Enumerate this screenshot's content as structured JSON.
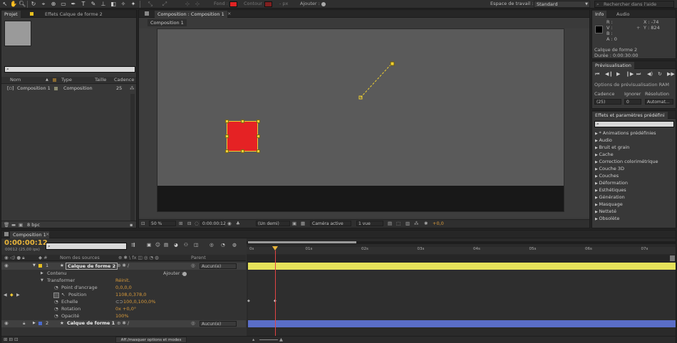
{
  "toolbar": {
    "fill_label": "Fond :",
    "stroke_label": "Contour :",
    "px_label": "- px",
    "add_label": "Ajouter :",
    "workspace_label": "Espace de travail :",
    "workspace_value": "Standard",
    "search_placeholder": "Rechercher dans l'aide",
    "fill_color": "#e02424",
    "stroke_color": "#e02424"
  },
  "project": {
    "tab_project": "Projet",
    "tab_effects": "Effets Calque de forme 2",
    "col_name": "Nom",
    "col_type": "Type",
    "col_size": "Taille",
    "col_rate": "Cadence",
    "item_name": "Composition 1",
    "item_type": "Composition",
    "item_rate": "25",
    "bpc": "8 bpc"
  },
  "comp": {
    "tab_title": "Composition : Composition 1",
    "sub_tab": "Composition 1",
    "zoom": "50 %",
    "time": "0:00:00:12",
    "resolution": "(Un demi)",
    "camera": "Caméra active",
    "views": "1 vue",
    "exposure": "+0,0"
  },
  "info": {
    "tab_info": "Info",
    "tab_audio": "Audio",
    "r": "R :",
    "g": "V :",
    "b": "B :",
    "a": "A : 0",
    "x": "X : -74",
    "y": "Y : 824",
    "layer": "Calque de forme 2",
    "duration": "Durée : 0:00:30:00"
  },
  "preview": {
    "title": "Prévisualisation",
    "ram_options": "Options de prévisualisation RAM",
    "cadence_label": "Cadence",
    "skip_label": "Ignorer",
    "res_label": "Résolution",
    "cadence_value": "(25)",
    "skip_value": "0",
    "res_value": "Automat..."
  },
  "effects": {
    "title": "Effets et paramètres prédéfini",
    "items": [
      "* Animations prédéfinies",
      "Audio",
      "Bruit et grain",
      "Cache",
      "Correction colorimétrique",
      "Couche 3D",
      "Couches",
      "Déformation",
      "Esthétiques",
      "Génération",
      "Masquage",
      "Netteté",
      "Obsolète"
    ]
  },
  "timeline": {
    "tab": "Composition 1",
    "timecode": "0:00:00:12",
    "frames": "00012 (25,00 ips)",
    "col_source": "Nom des sources",
    "col_parent": "Parent",
    "ruler": [
      "0s",
      "01s",
      "02s",
      "03s",
      "04s",
      "05s",
      "06s",
      "07s"
    ],
    "layer1_num": "1",
    "layer1_name": "Calque de forme 2",
    "layer1_parent": "Aucun(e)",
    "contenu": "Contenu",
    "ajouter": "Ajouter :",
    "transformer": "Transformer",
    "reinit": "Réinit.",
    "anchor_label": "Point d'ancrage",
    "anchor_value": "0,0,0,0",
    "position_label": "Position",
    "position_value": "1108,0,378,0",
    "scale_label": "Echelle",
    "scale_value": "100,0,100,0%",
    "rotation_label": "Rotation",
    "rotation_value": "0x +0,0°",
    "opacity_label": "Opacité",
    "opacity_value": "100%",
    "layer2_num": "2",
    "layer2_name": "Calque de forme 1",
    "layer2_parent": "Aucun(e)",
    "footer": "Aff./masquer options et modes"
  }
}
